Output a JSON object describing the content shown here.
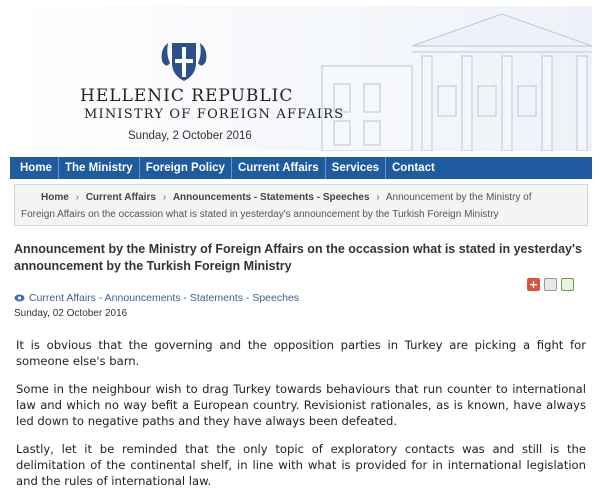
{
  "header": {
    "title_line1": "HELLENIC REPUBLIC",
    "title_line2": "MINISTRY OF FOREIGN AFFAIRS",
    "date": "Sunday, 2 October 2016"
  },
  "nav": {
    "items": [
      "Home",
      "The Ministry",
      "Foreign Policy",
      "Current Affairs",
      "Services",
      "Contact"
    ]
  },
  "breadcrumb": {
    "home": "Home",
    "current_affairs": "Current Affairs",
    "announcements": "Announcements - Statements - Speeches",
    "current_line1": "Announcement by the Ministry of",
    "current_line2": "Foreign Affairs on the occassion what is stated in yesterday's announcement by the Turkish Foreign Ministry"
  },
  "article": {
    "headline": "Announcement by the Ministry of Foreign Affairs on the occassion what is stated in yesterday's announcement by the Turkish Foreign Ministry",
    "category": "Current Affairs - Announcements - Statements - Speeches",
    "date": "Sunday, 02 October 2016",
    "paragraphs": [
      "It is obvious that the governing and the opposition parties in Turkey are picking a fight for someone else's barn.",
      "Some in the neighbour wish to drag Turkey towards behaviours that run counter to international law and which no way befit a European country. Revisionist rationales, as is known, have always led down to negative paths and they have always been defeated.",
      "Lastly, let it be reminded that the only topic of exploratory contacts was and still is the delimitation of the continental shelf, in line with what is provided for in international legislation and the rules of international law."
    ]
  },
  "tools": {
    "icons": [
      "plus-icon",
      "print-icon",
      "email-icon"
    ],
    "plus_glyph": "+"
  }
}
